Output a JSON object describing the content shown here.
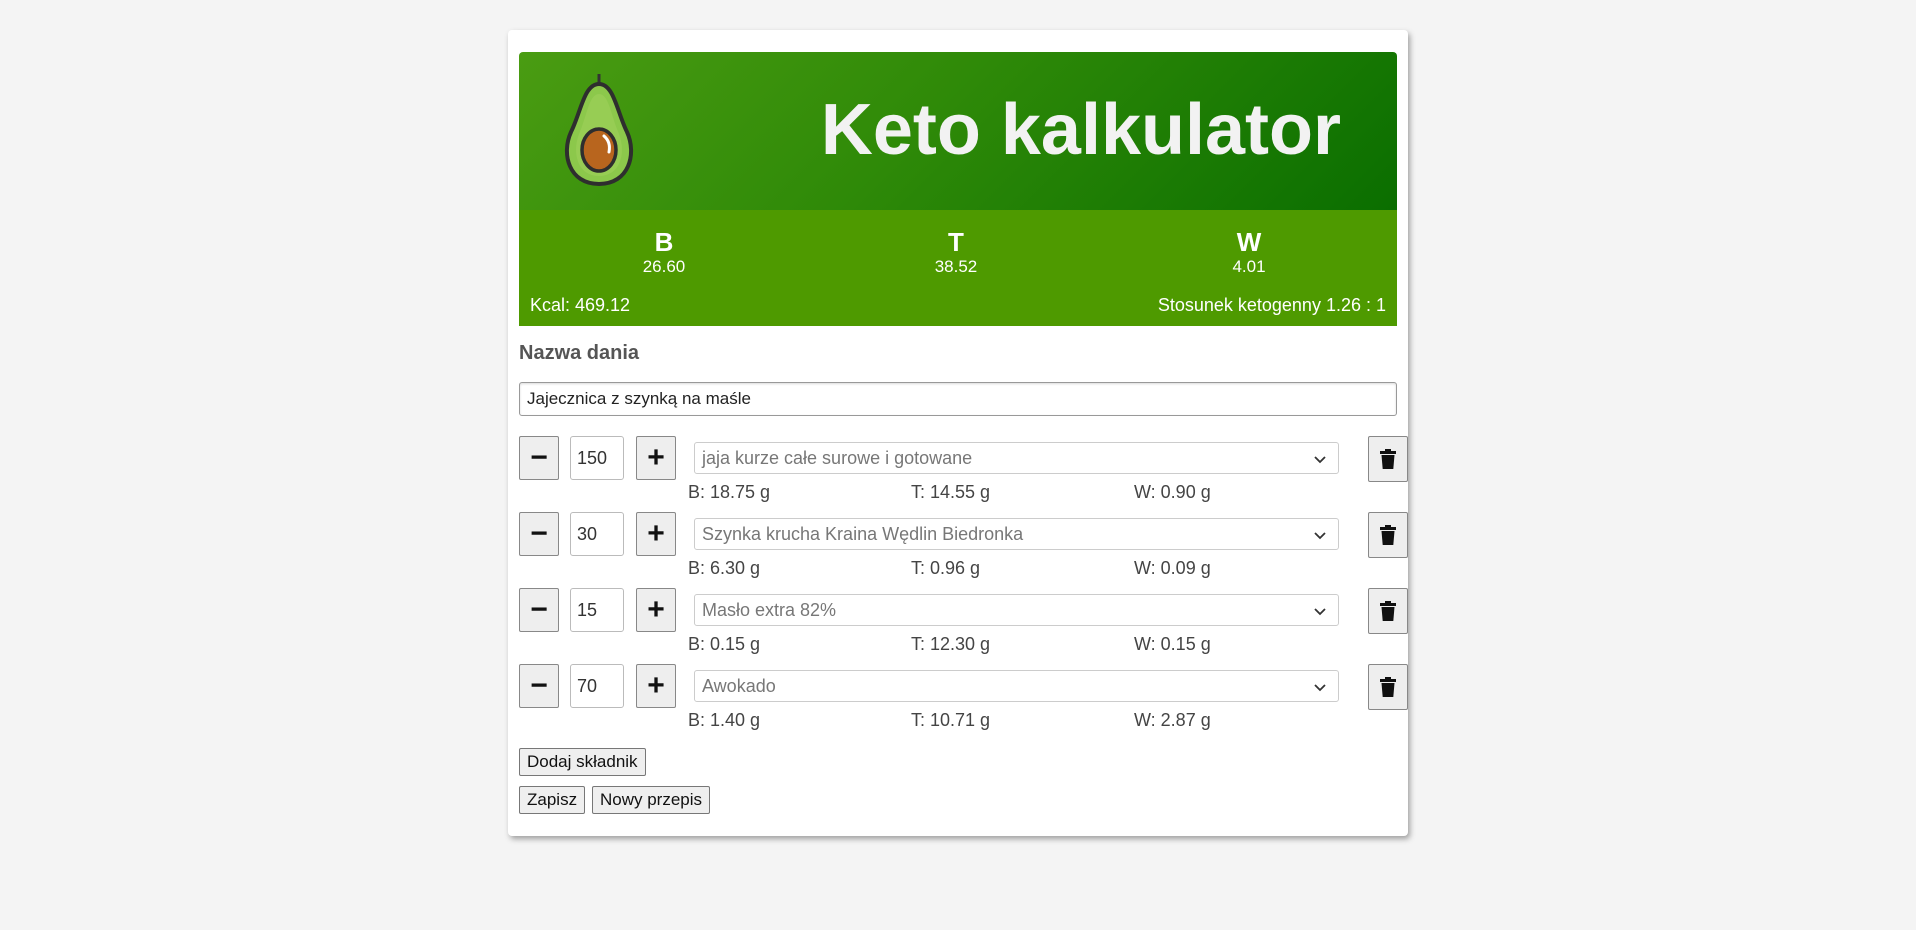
{
  "header": {
    "title": "Keto kalkulator"
  },
  "macros": {
    "protein": {
      "label": "B",
      "value": "26.60"
    },
    "fat": {
      "label": "T",
      "value": "38.52"
    },
    "carbs": {
      "label": "W",
      "value": "4.01"
    },
    "kcal": "Kcal: 469.12",
    "ratio": "Stosunek ketogenny 1.26 : 1"
  },
  "dish": {
    "label": "Nazwa dania",
    "value": "Jajecznica z szynką na maśle"
  },
  "ingredients": [
    {
      "qty": "150",
      "name": "jaja kurze całe surowe i gotowane",
      "b": "B: 18.75 g",
      "t": "T: 14.55 g",
      "w": "W: 0.90 g"
    },
    {
      "qty": "30",
      "name": "Szynka krucha Kraina Wędlin Biedronka",
      "b": "B: 6.30 g",
      "t": "T: 0.96 g",
      "w": "W: 0.09 g"
    },
    {
      "qty": "15",
      "name": "Masło extra 82%",
      "b": "B: 0.15 g",
      "t": "T: 12.30 g",
      "w": "W: 0.15 g"
    },
    {
      "qty": "70",
      "name": "Awokado",
      "b": "B: 1.40 g",
      "t": "T: 10.71 g",
      "w": "W: 2.87 g"
    }
  ],
  "buttons": {
    "minus": "−",
    "plus": "+",
    "add": "Dodaj składnik",
    "save": "Zapisz",
    "new": "Nowy przepis"
  },
  "colors": {
    "header_dark": "#0a6e00",
    "header_light": "#4a9c12",
    "macro_bar": "#4e9a00"
  }
}
